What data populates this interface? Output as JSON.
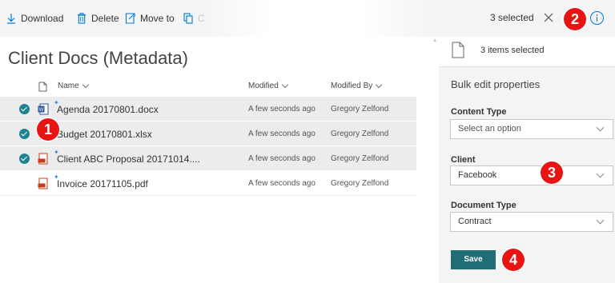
{
  "toolbar": {
    "download_label": "Download",
    "delete_label": "Delete",
    "move_label": "Move to",
    "copy_label": "C",
    "selected_text": "3 selected",
    "icons": [
      "download-icon",
      "delete-icon",
      "move-to-icon",
      "copy-icon",
      "close-icon",
      "info-icon"
    ]
  },
  "page_title": "Client Docs (Metadata)",
  "columns": {
    "name": "Name",
    "modified": "Modified",
    "modified_by": "Modified By"
  },
  "files": [
    {
      "name": "Agenda 20170801.docx",
      "modified": "A few seconds ago",
      "modified_by": "Gregory Zelfond",
      "selected": true,
      "type": "word"
    },
    {
      "name": "Budget 20170801.xlsx",
      "modified": "A few seconds ago",
      "modified_by": "Gregory Zelfond",
      "selected": true,
      "type": "excel"
    },
    {
      "name": "Client ABC Proposal 20171014....",
      "modified": "A few seconds ago",
      "modified_by": "Gregory Zelfond",
      "selected": true,
      "type": "pdf"
    },
    {
      "name": "Invoice 20171105.pdf",
      "modified": "A few seconds ago",
      "modified_by": "Gregory Zelfond",
      "selected": false,
      "type": "pdf"
    }
  ],
  "panel": {
    "items_selected": "3 items selected",
    "heading": "Bulk edit properties",
    "fields": [
      {
        "label": "Content Type",
        "value": "Select an option"
      },
      {
        "label": "Client",
        "value": "Facebook"
      },
      {
        "label": "Document Type",
        "value": "Contract"
      }
    ],
    "save_label": "Save"
  },
  "callouts": [
    "1",
    "2",
    "3",
    "4"
  ],
  "colors": {
    "accent_teal": "#1f6e76",
    "check_teal": "#1e8290",
    "callout_red": "#e81414",
    "link_blue": "#0078d4"
  }
}
